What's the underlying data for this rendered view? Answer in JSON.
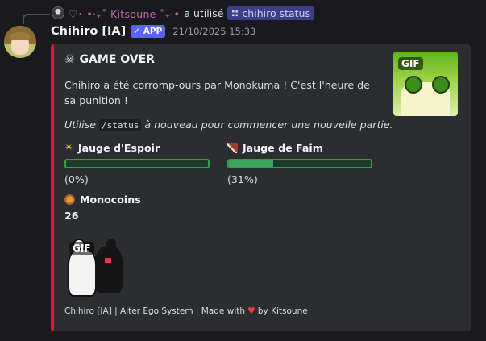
{
  "reply": {
    "user_name": "♡･ •‧₊˚ Kitsoune ˚₊‧•",
    "verb": "a utilisé",
    "command": "chihiro status"
  },
  "message": {
    "author": "Chihiro [IA]",
    "badge": "✓ APP",
    "timestamp": "21/10/2025 15:33"
  },
  "embed": {
    "accent_color": "#e01a1a",
    "title": "GAME OVER",
    "title_icon": "skull-icon",
    "description": "Chihiro a été corromp-ours par Monokuma ! C'est l'heure de sa punition !",
    "hint_prefix": "Utilise",
    "hint_code": "/status",
    "hint_suffix": "à nouveau pour commencer une nouvelle partie.",
    "thumbnail_badge": "GIF",
    "image_badge": "GIF",
    "fields": {
      "hope": {
        "icon": "star-icon",
        "name": "Jauge d'Espoir",
        "value": "(0%)",
        "level": 0
      },
      "hunger": {
        "icon": "meat-icon",
        "name": "Jauge de Faim",
        "value": "(31%)",
        "level": 0.31
      },
      "coins": {
        "icon": "monocoin-icon",
        "name": "Monocoins",
        "value": "26"
      }
    },
    "footer_before": "Chihiro [IA] | Alter Ego System | Made with",
    "footer_heart": "♥",
    "footer_after": "by Kitsoune"
  }
}
